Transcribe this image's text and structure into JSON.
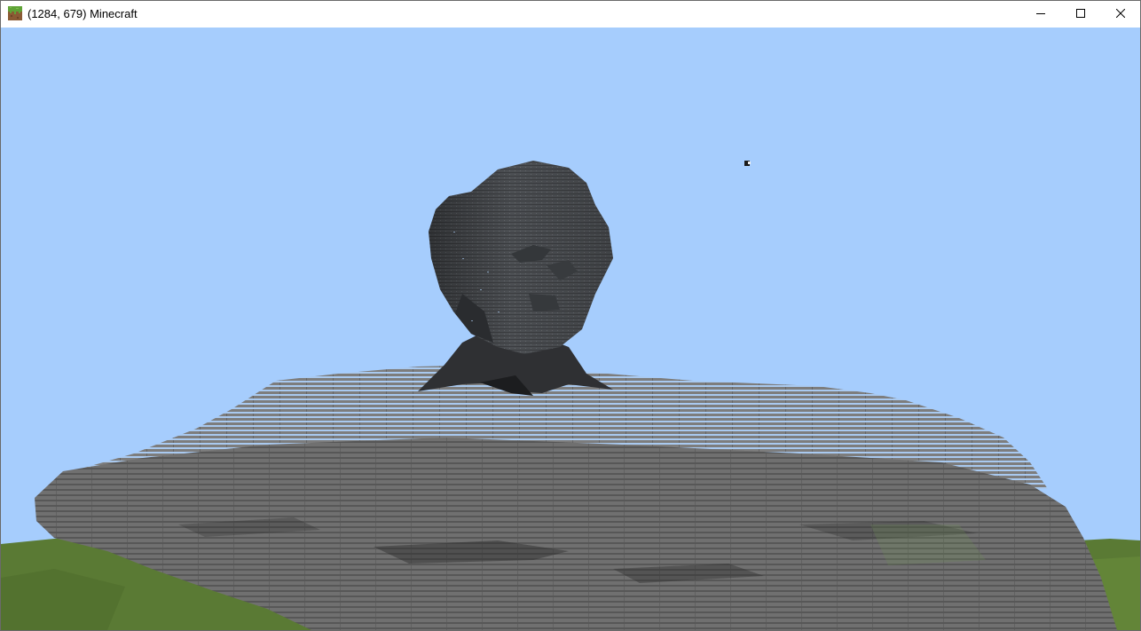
{
  "window": {
    "title": "(1284, 679) Minecraft",
    "app_icon": "grass-block-icon",
    "controls": {
      "minimize": "minimize-icon",
      "maximize": "maximize-icon",
      "close": "close-icon"
    }
  },
  "scene": {
    "sky_color": "#a6cdfd",
    "grass_color": "#5a7a34",
    "stone_color": "#7b7b7b",
    "statue_color": "#4b4e52",
    "description_icon": "voxel-statue-scene"
  }
}
